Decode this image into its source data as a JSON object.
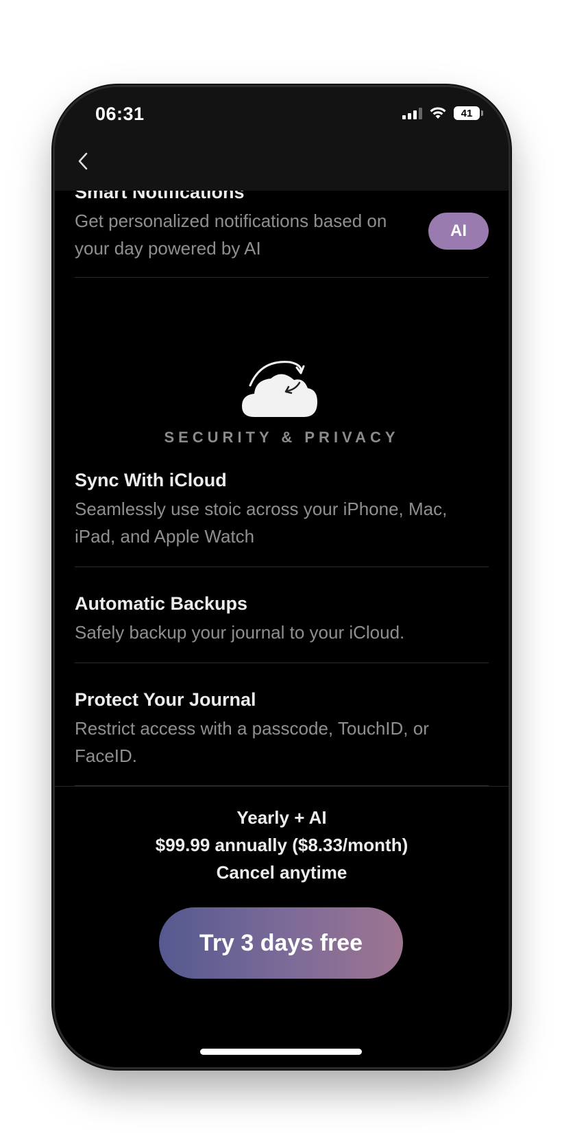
{
  "status_bar": {
    "time": "06:31",
    "battery": "41"
  },
  "features_top": [
    {
      "title": "Smart Notifications",
      "description": "Get personalized notifications based on your day powered by AI",
      "badge": "AI"
    }
  ],
  "section": {
    "icon": "icloud-sync-icon",
    "title": "SECURITY & PRIVACY"
  },
  "features": [
    {
      "title": "Sync With iCloud",
      "description": "Seamlessly use stoic across your iPhone, Mac, iPad, and Apple Watch"
    },
    {
      "title": "Automatic Backups",
      "description": "Safely backup your journal to your iCloud."
    },
    {
      "title": "Protect Your Journal",
      "description": "Restrict access with a passcode, TouchID, or FaceID."
    }
  ],
  "plan": {
    "name": "Yearly + AI",
    "price": "$99.99 annually ($8.33/month)",
    "note": "Cancel anytime"
  },
  "cta": {
    "label": "Try 3 days free"
  },
  "colors": {
    "ai_badge": "#9a7bb0",
    "cta_start": "#55598f",
    "cta_end": "#9e7591"
  }
}
